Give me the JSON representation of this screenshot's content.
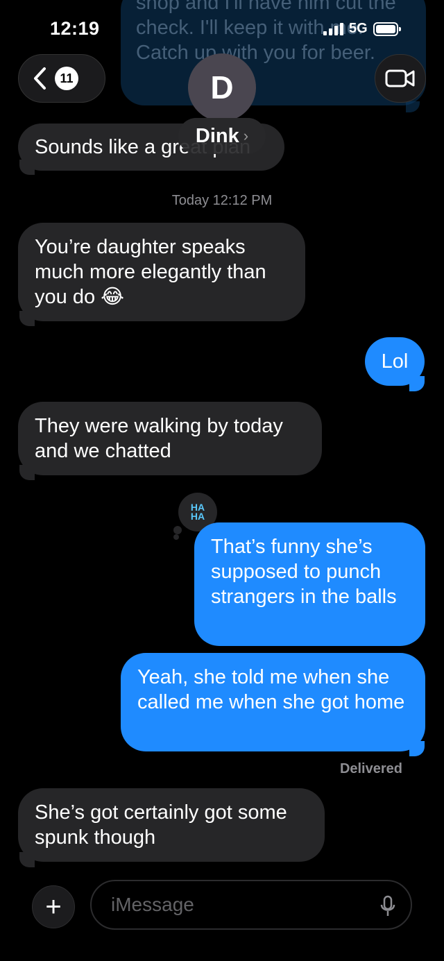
{
  "status_bar": {
    "time": "12:19",
    "network": "5G"
  },
  "header": {
    "back_count": "11",
    "contact_initial": "D",
    "contact_name": "Dink",
    "name_chevron": "›"
  },
  "ghost_message": "shop and I'll have him cut the check. I'll keep it with me. Catch up with you for beer.",
  "earlier_message": "Sounds like a great plan",
  "timestamp": "Today 12:12 PM",
  "messages": [
    {
      "direction": "in",
      "text": "You’re daughter speaks much more elegantly than you do 😂"
    },
    {
      "direction": "out",
      "text": "Lol"
    },
    {
      "direction": "in",
      "text": "They were walking by today and we chatted"
    },
    {
      "direction": "out",
      "text": "That’s funny she’s supposed to punch strangers in the balls"
    },
    {
      "direction": "out",
      "text": "Yeah, she told me when she called me when she got home"
    },
    {
      "direction": "in",
      "text": "She’s got certainly got some spunk though"
    }
  ],
  "reaction": {
    "line1": "HA",
    "line2": "HA"
  },
  "delivered_label": "Delivered",
  "composer": {
    "add_label": "+",
    "placeholder": "iMessage"
  },
  "icons": {
    "back": "chevron-left-icon",
    "video": "video-camera-icon",
    "mic": "microphone-icon",
    "add": "plus-icon"
  },
  "colors": {
    "incoming_bubble": "#262628",
    "outgoing_bubble": "#1f8bff",
    "background": "#000000"
  }
}
